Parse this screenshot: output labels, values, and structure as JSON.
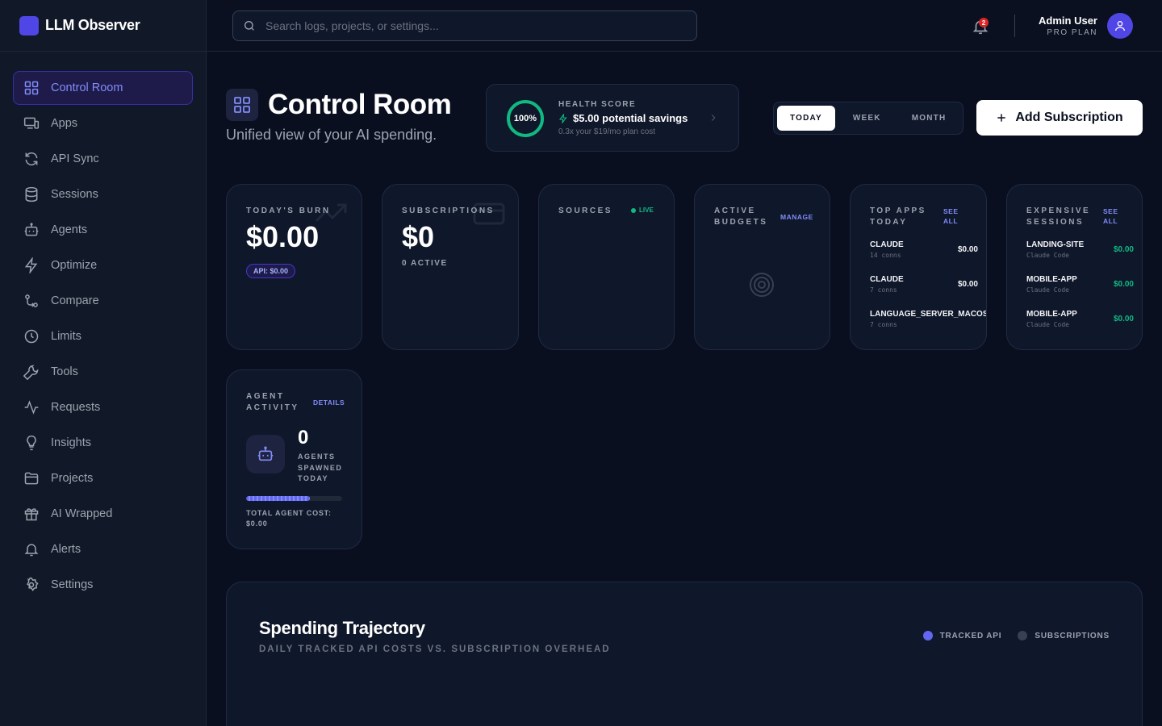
{
  "brand": {
    "name": "LLM Observer",
    "color": "#4f46e5"
  },
  "sidebar": {
    "items": [
      {
        "label": "Control Room",
        "icon": "grid-icon",
        "active": true
      },
      {
        "label": "Apps",
        "icon": "devices-icon"
      },
      {
        "label": "API Sync",
        "icon": "refresh-icon"
      },
      {
        "label": "Sessions",
        "icon": "database-icon"
      },
      {
        "label": "Agents",
        "icon": "robot-icon"
      },
      {
        "label": "Optimize",
        "icon": "bolt-icon"
      },
      {
        "label": "Compare",
        "icon": "git-compare-icon"
      },
      {
        "label": "Limits",
        "icon": "clock-icon"
      },
      {
        "label": "Tools",
        "icon": "wrench-icon"
      },
      {
        "label": "Requests",
        "icon": "activity-icon"
      },
      {
        "label": "Insights",
        "icon": "lightbulb-icon"
      },
      {
        "label": "Projects",
        "icon": "folder-icon"
      },
      {
        "label": "AI Wrapped",
        "icon": "gift-icon"
      },
      {
        "label": "Alerts",
        "icon": "bell-icon"
      },
      {
        "label": "Settings",
        "icon": "gear-icon"
      }
    ]
  },
  "header": {
    "search_placeholder": "Search logs, projects, or settings...",
    "notification_count": "2",
    "user_name": "Admin User",
    "user_plan": "PRO PLAN"
  },
  "page": {
    "title": "Control Room",
    "subtitle": "Unified view of your AI spending."
  },
  "health": {
    "label": "HEALTH SCORE",
    "percent_text": "100%",
    "percent": 100,
    "savings": "$5.00 potential savings",
    "note": "0.3x your $19/mo plan cost",
    "color": "#10b981"
  },
  "range": {
    "options": [
      "TODAY",
      "WEEK",
      "MONTH"
    ],
    "selected": "TODAY"
  },
  "add_button": {
    "label": "Add Subscription"
  },
  "cards": {
    "burn": {
      "label": "TODAY'S BURN",
      "value": "$0.00",
      "pill": "API: $0.00"
    },
    "subscriptions": {
      "label": "SUBSCRIPTIONS",
      "value": "$0",
      "note": "0 ACTIVE"
    },
    "sources": {
      "label": "SOURCES",
      "live": "LIVE"
    },
    "budgets": {
      "label": "ACTIVE BUDGETS",
      "link": "MANAGE"
    },
    "top_apps": {
      "label": "TOP APPS TODAY",
      "link": "SEE ALL",
      "rows": [
        {
          "name": "CLAUDE",
          "sub": "14 conns",
          "value": "$0.00"
        },
        {
          "name": "CLAUDE",
          "sub": "7 conns",
          "value": "$0.00"
        },
        {
          "name": "LANGUAGE_SERVER_MACOS_AR",
          "sub": "7 conns",
          "value": ""
        }
      ]
    },
    "sessions": {
      "label": "EXPENSIVE SESSIONS",
      "link": "SEE ALL",
      "rows": [
        {
          "name": "LANDING-SITE",
          "sub": "Claude Code",
          "value": "$0.00"
        },
        {
          "name": "MOBILE-APP",
          "sub": "Claude Code",
          "value": "$0.00"
        },
        {
          "name": "MOBILE-APP",
          "sub": "Claude Code",
          "value": "$0.00"
        }
      ]
    },
    "agents": {
      "label": "AGENT ACTIVITY",
      "link": "DETAILS",
      "count": "0",
      "sub": "AGENTS SPAWNED TODAY",
      "progress": 0.66,
      "total": "TOTAL AGENT COST: $0.00"
    }
  },
  "trajectory": {
    "title": "Spending Trajectory",
    "subtitle": "DAILY TRACKED API COSTS VS. SUBSCRIPTION OVERHEAD",
    "legend": [
      {
        "label": "TRACKED API",
        "color": "#6366f1"
      },
      {
        "label": "SUBSCRIPTIONS",
        "color": "#374151"
      }
    ]
  }
}
